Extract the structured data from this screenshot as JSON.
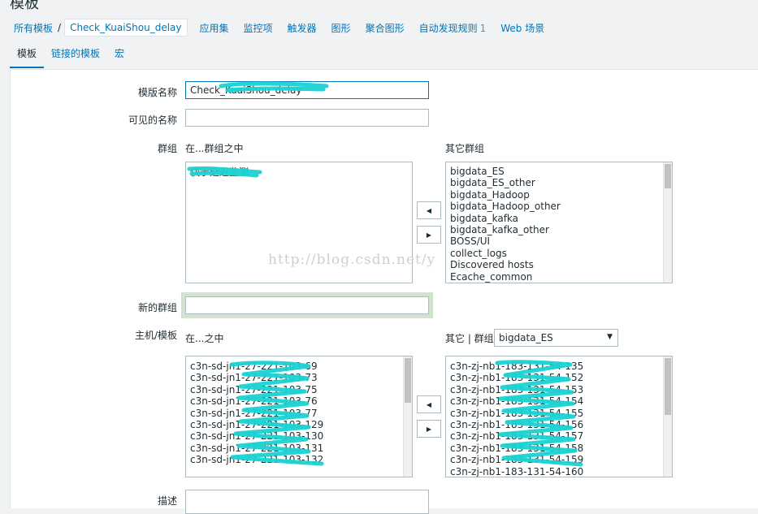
{
  "page": {
    "title": "模板"
  },
  "breadcrumb": {
    "all_templates": "所有模板",
    "separator": "/",
    "current": "Check_KuaiShou_delay"
  },
  "nav": {
    "applications": "应用集",
    "items": "监控项",
    "triggers": "触发器",
    "graphs": "图形",
    "screens": "聚合图形",
    "discovery": "自动发现规则",
    "discovery_count": "1",
    "web": "Web 场景"
  },
  "tabs": {
    "template": "模板",
    "linked": "链接的模板",
    "macros": "宏"
  },
  "form": {
    "template_name_label": "模版名称",
    "template_name_value": "Check_KuaiShou_delay",
    "visible_name_label": "可见的名称",
    "visible_name_value": "",
    "groups_label": "群组",
    "in_groups_label": "在...群组之中",
    "other_groups_label": "其它群组",
    "in_groups": [
      "快手延迟监测"
    ],
    "other_groups": [
      "bigdata_ES",
      "bigdata_ES_other",
      "bigdata_Hadoop",
      "bigdata_Hadoop_other",
      "bigdata_kafka",
      "bigdata_kafka_other",
      "BOSS/UI",
      "collect_logs",
      "Discovered hosts",
      "Ecache_common"
    ],
    "new_group_label": "新的群组",
    "new_group_value": "",
    "hosts_label": "主机/模板",
    "in_hosts_label": "在...之中",
    "other_hosts_label": "其它 | 群组",
    "host_group_selected": "bigdata_ES",
    "in_hosts": [
      "c3n-sd-jn1-27-221-103-69",
      "c3n-sd-jn1-27-221-103-73",
      "c3n-sd-jn1-27-221-103-75",
      "c3n-sd-jn1-27-221-103-76",
      "c3n-sd-jn1-27-221-103-77",
      "c3n-sd-jn1-27-221-103-129",
      "c3n-sd-jn1-27-221-103-130",
      "c3n-sd-jn1-27-221-103-131",
      "c3n-sd-jn1-27-221-103-132"
    ],
    "other_hosts": [
      "c3n-zj-nb1-183-131-54-135",
      "c3n-zj-nb1-183-131-54-152",
      "c3n-zj-nb1-183-131-54-153",
      "c3n-zj-nb1-183-131-54-154",
      "c3n-zj-nb1-183-131-54-155",
      "c3n-zj-nb1-183-131-54-156",
      "c3n-zj-nb1-183-131-54-157",
      "c3n-zj-nb1-183-131-54-158",
      "c3n-zj-nb1-183-131-54-159",
      "c3n-zj-nb1-183-131-54-160"
    ],
    "description_label": "描述",
    "move_left": "◀",
    "move_right": "▶"
  },
  "watermark": "http://blog.csdn.net/y",
  "colors": {
    "link": "#0275b8",
    "scribble": "#19d3d3"
  }
}
